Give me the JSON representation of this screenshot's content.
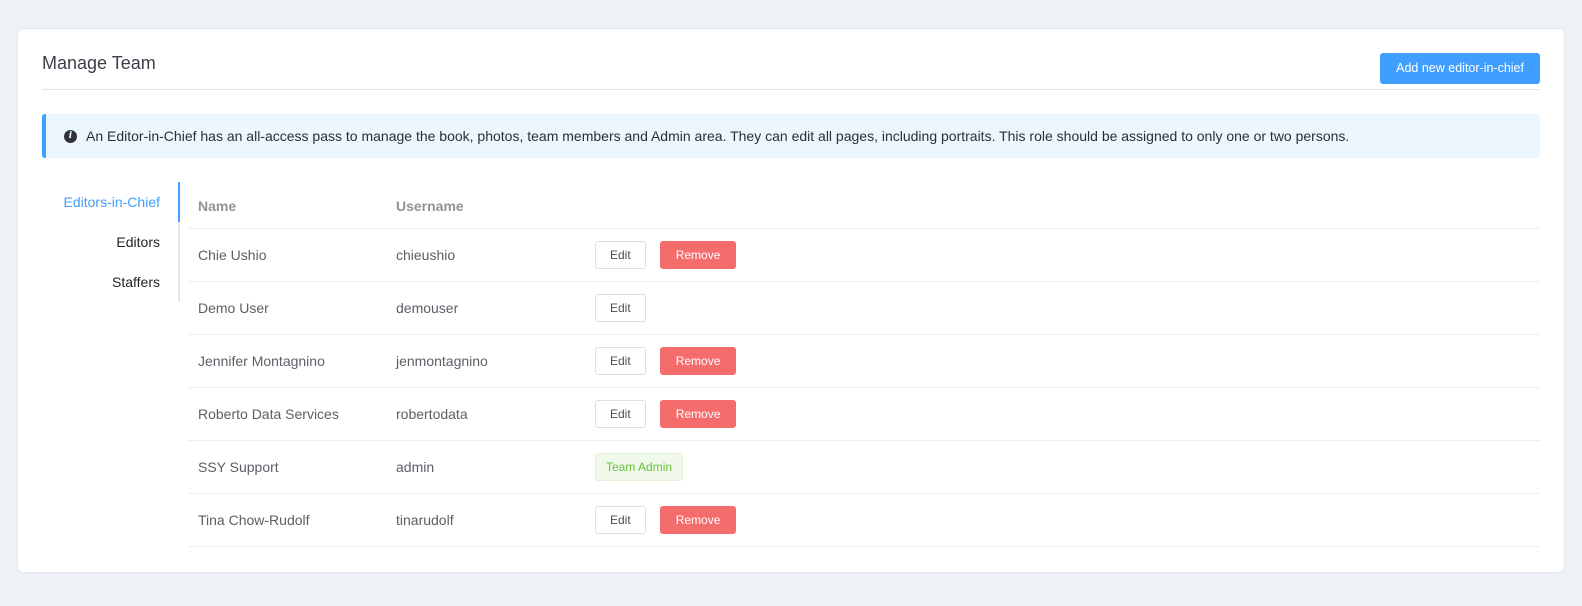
{
  "header": {
    "title": "Manage Team",
    "add_button_label": "Add new editor-in-chief"
  },
  "info": {
    "icon": "info-circle-icon",
    "text": "An Editor-in-Chief has an all-access pass to manage the book, photos, team members and Admin area. They can edit all pages, including portraits. This role should be assigned to only one or two persons."
  },
  "side_nav": {
    "items": [
      {
        "label": "Editors-in-Chief",
        "active": true
      },
      {
        "label": "Editors",
        "active": false
      },
      {
        "label": "Staffers",
        "active": false
      }
    ]
  },
  "table": {
    "columns": [
      "Name",
      "Username"
    ],
    "rows": [
      {
        "name": "Chie Ushio",
        "username": "chieushio"
      },
      {
        "name": "Demo User",
        "username": "demouser"
      },
      {
        "name": "Jennifer Montagnino",
        "username": "jenmontagnino"
      },
      {
        "name": "Roberto Data Services",
        "username": "robertodata"
      },
      {
        "name": "SSY Support",
        "username": "admin"
      },
      {
        "name": "Tina Chow-Rudolf",
        "username": "tinarudolf"
      }
    ],
    "edit_label": "Edit",
    "remove_label": "Remove",
    "team_admin_label": "Team Admin"
  },
  "colors": {
    "primary": "#409eff",
    "danger": "#f56c6c",
    "success": "#67c23a",
    "page_background": "#eef2f7",
    "info_background": "#ecf6ff"
  }
}
